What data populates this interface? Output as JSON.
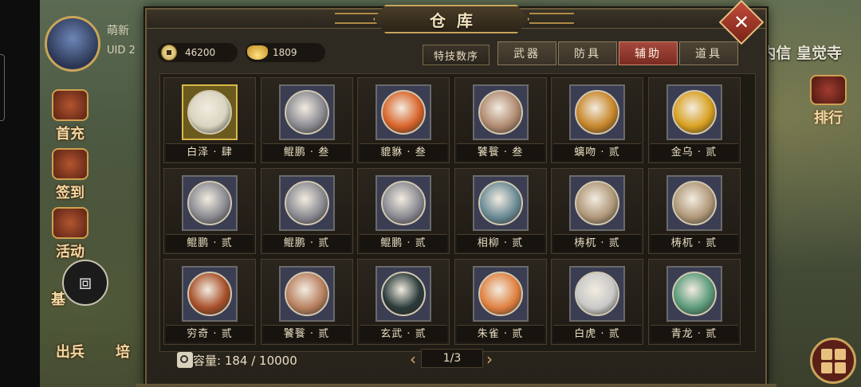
{
  "player": {
    "name": "萌新",
    "uid_label": "UID 2"
  },
  "side_menu": {
    "first_recharge": "首充",
    "sign_in": "签到",
    "activity": "活动",
    "base": "基",
    "deploy": "出兵",
    "train": "培"
  },
  "background": {
    "right_title": "内信 皇觉寺",
    "rank_label": "排行"
  },
  "panel": {
    "title": "仓库",
    "close_glyph": "✕",
    "currencies": [
      {
        "icon": "copper-coin-icon",
        "value": "46200"
      },
      {
        "icon": "gold-ingot-icon",
        "value": "1809"
      }
    ],
    "sort_button": "特技数序",
    "tabs": [
      {
        "label": "武器",
        "active": false
      },
      {
        "label": "防具",
        "active": false
      },
      {
        "label": "辅助",
        "active": true
      },
      {
        "label": "道具",
        "active": false
      }
    ],
    "items": [
      {
        "name": "白泽 · 肆",
        "gold": true,
        "color": "#d9d4c0"
      },
      {
        "name": "鲲鹏 · 叁",
        "gold": false,
        "color": "#8a8a92"
      },
      {
        "name": "貔貅 · 叁",
        "gold": false,
        "color": "#d8642a"
      },
      {
        "name": "饕餮 · 叁",
        "gold": false,
        "color": "#b08a70"
      },
      {
        "name": "螭吻 · 贰",
        "gold": false,
        "color": "#c8862a"
      },
      {
        "name": "金乌 · 贰",
        "gold": false,
        "color": "#d8a020"
      },
      {
        "name": "鲲鹏 · 贰",
        "gold": false,
        "color": "#8a8a92"
      },
      {
        "name": "鲲鹏 · 贰",
        "gold": false,
        "color": "#8a8a92"
      },
      {
        "name": "鲲鹏 · 贰",
        "gold": false,
        "color": "#8a8a92"
      },
      {
        "name": "相柳 · 贰",
        "gold": false,
        "color": "#6a8a96"
      },
      {
        "name": "梼杌 · 贰",
        "gold": false,
        "color": "#b0987a"
      },
      {
        "name": "梼杌 · 贰",
        "gold": false,
        "color": "#b0987a"
      },
      {
        "name": "穷奇 · 贰",
        "gold": false,
        "color": "#a8502a"
      },
      {
        "name": "饕餮 · 贰",
        "gold": false,
        "color": "#b88060"
      },
      {
        "name": "玄武 · 贰",
        "gold": false,
        "color": "#2a3a3a"
      },
      {
        "name": "朱雀 · 贰",
        "gold": false,
        "color": "#e08040"
      },
      {
        "name": "白虎 · 贰",
        "gold": false,
        "color": "#c8c8c8"
      },
      {
        "name": "青龙 · 贰",
        "gold": false,
        "color": "#5a9a7a"
      }
    ],
    "capacity_text": "容量: 184 / 10000",
    "page_text": "1/3",
    "prev_glyph": "‹",
    "next_glyph": "›"
  }
}
